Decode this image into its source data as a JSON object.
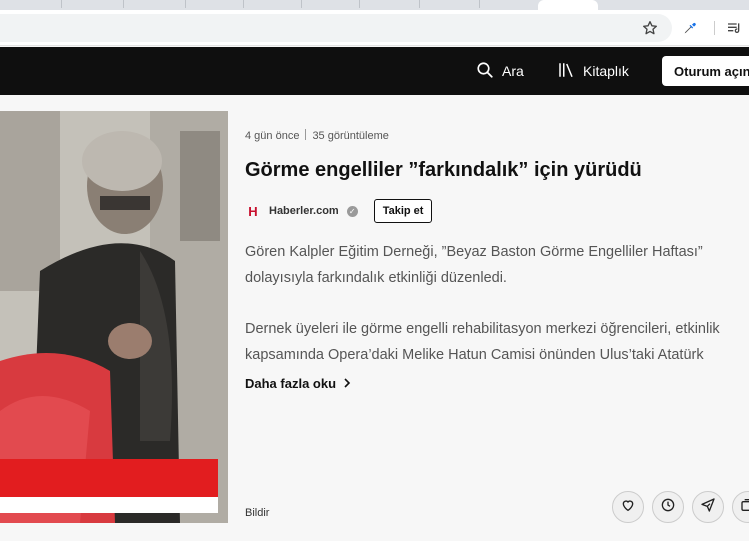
{
  "navbar": {
    "search_label": "Ara",
    "library_label": "Kitaplık",
    "signin_label": "Oturum açın"
  },
  "article": {
    "age": "4 gün önce",
    "views": "35 görüntüleme",
    "title": "Görme engelliler ”farkındalık” için yürüdü",
    "source_logo": "H",
    "source_name": "Haberler.com",
    "follow_label": "Takip et",
    "paragraph1_line1": "Gören Kalpler Eğitim Derneği, ”Beyaz Baston Görme Engelliler Haftası”",
    "paragraph1_line2": "dolayısıyla farkındalık etkinliği düzenledi.",
    "paragraph2_line1": "Dernek üyeleri ile görme engelli rehabilitasyon merkezi öğrencileri, etkinlik",
    "paragraph2_line2": "kapsamında Opera’daki Melike Hatun Camisi önünden Ulus’taki Atatürk",
    "read_more": "Daha fazla oku",
    "report_label": "Bildir"
  },
  "icons": {
    "toolbar": [
      "star-icon",
      "eyedropper-icon",
      "reading-list-icon"
    ],
    "navbar": [
      "search-icon",
      "library-icon"
    ],
    "actions": [
      "heart-icon",
      "clock-icon",
      "share-icon",
      "collection-icon"
    ]
  },
  "colors": {
    "navbar_bg": "#0f0f0f",
    "source_logo": "#c8102e",
    "page_bg": "#f7f7f7"
  }
}
